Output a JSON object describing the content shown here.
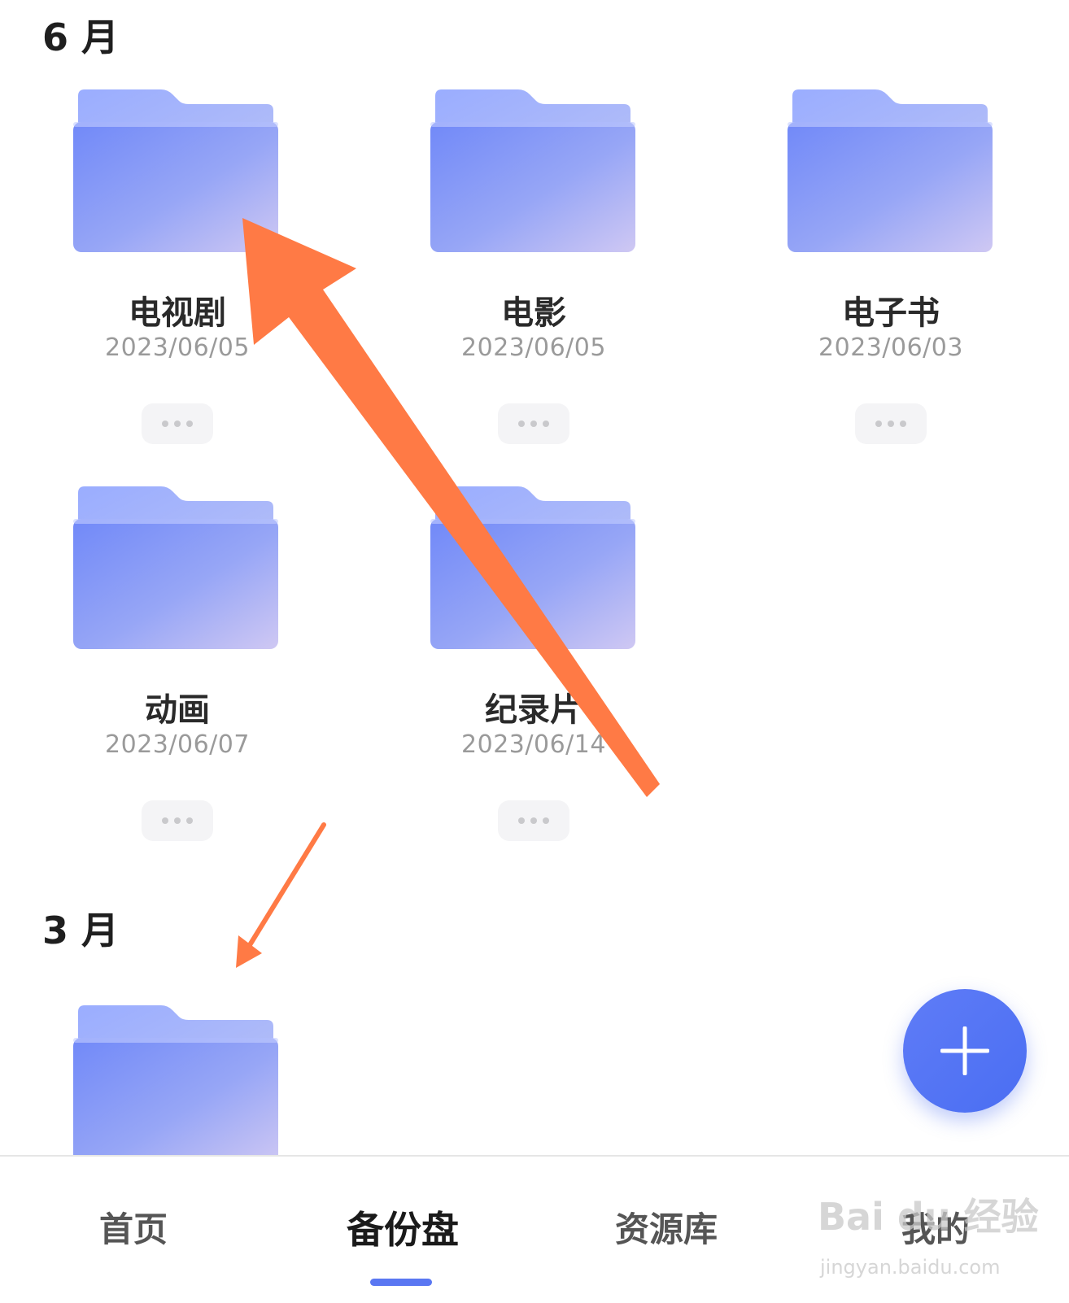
{
  "sections": [
    {
      "month": "6 月"
    },
    {
      "month": "3 月"
    }
  ],
  "folders": [
    {
      "name": "电视剧",
      "date": "2023/06/05"
    },
    {
      "name": "电影",
      "date": "2023/06/05"
    },
    {
      "name": "电子书",
      "date": "2023/06/03"
    },
    {
      "name": "动画",
      "date": "2023/06/07"
    },
    {
      "name": "纪录片",
      "date": "2023/06/14"
    }
  ],
  "tabs": [
    {
      "label": "首页"
    },
    {
      "label": "备份盘"
    },
    {
      "label": "资源库"
    },
    {
      "label": "我的"
    }
  ],
  "watermark": {
    "text": "Bai du 经验",
    "url_text": "jingyan.baidu.com"
  },
  "colors": {
    "accent": "#5a77f2",
    "arrow": "#ff7a45",
    "folder": "#8aa0ff"
  }
}
